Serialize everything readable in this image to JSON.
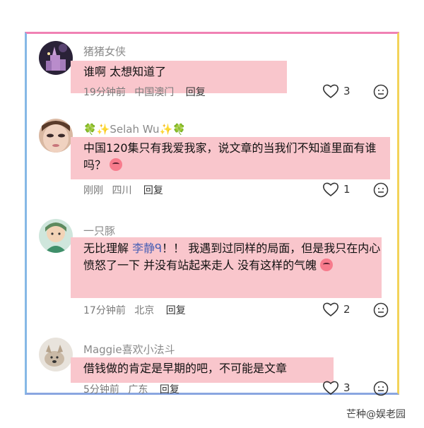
{
  "comments": [
    {
      "username": "猪猪女侠",
      "text": "谁啊 太想知道了",
      "time": "19分钟前",
      "location": "中国澳门",
      "reply": "回复",
      "likes": "3",
      "avatar_icon": "avatar-castle-night"
    },
    {
      "username": "🍀✨Selah Wu✨🍀",
      "text": "中国120集只有我爱我家，说文章的当我们不知道里面有谁吗？",
      "time": "刚刚",
      "location": "四川",
      "reply": "回复",
      "likes": "1",
      "avatar_icon": "avatar-woman-face"
    },
    {
      "username": "一只豚",
      "text_part1": "无比理解 ",
      "mention": "李静ᑫ",
      "text_part2": "！！ 我遇到过同样的局面，但是我只在内心愤怒了一下 并没有站起来走人 没有这样的气魄",
      "time": "17分钟前",
      "location": "北京",
      "reply": "回复",
      "likes": "2",
      "avatar_icon": "avatar-cartoon-green"
    },
    {
      "username": "Maggie喜欢小法斗",
      "text": "借钱做的肯定是早期的吧，不可能是文章",
      "time": "5分钟前",
      "location": "广东",
      "reply": "回复",
      "likes": "3",
      "avatar_icon": "avatar-dog"
    }
  ],
  "watermark": "芒种@娱老园",
  "colors": {
    "highlight": "#f9c6cc",
    "mention": "#4a60b5"
  }
}
